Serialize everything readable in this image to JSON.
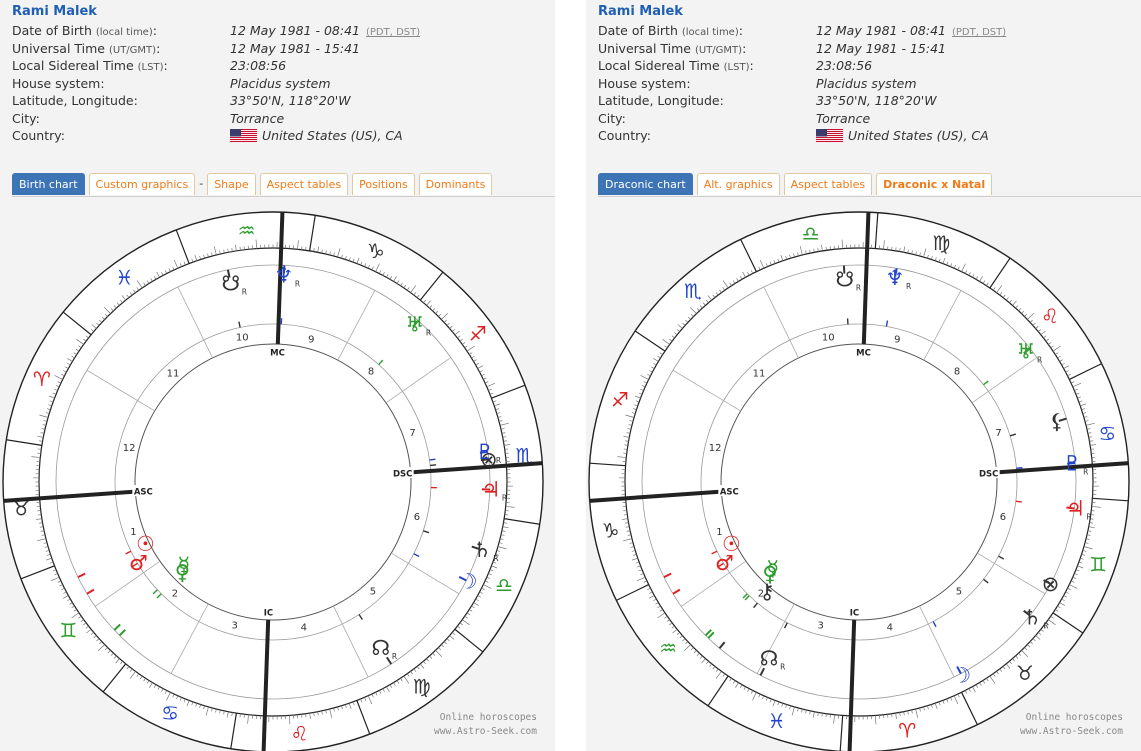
{
  "left": {
    "name": "Rami Malek",
    "fields": [
      {
        "label": "Date of Birth ",
        "small": "(local time)",
        "label_end": ":",
        "value": "12 May 1981 - 08:41",
        "note": "(PDT, DST)"
      },
      {
        "label": "Universal Time ",
        "small": "(UT/GMT)",
        "label_end": ":",
        "value": "12 May 1981 - 15:41"
      },
      {
        "label": "Local Sidereal Time ",
        "small": "(LST)",
        "label_end": ":",
        "value": "23:08:56"
      },
      {
        "label": "House system:",
        "small": "",
        "label_end": "",
        "value": "Placidus system"
      },
      {
        "label": "Latitude, Longitude:",
        "small": "",
        "label_end": "",
        "value": "33°50'N, 118°20'W"
      },
      {
        "label": "City:",
        "small": "",
        "label_end": "",
        "value": "Torrance"
      },
      {
        "label": "Country:",
        "small": "",
        "label_end": "",
        "value": "United States (US), CA"
      }
    ],
    "tabs": [
      "Birth chart",
      "Custom graphics",
      "-",
      "Shape",
      "Aspect tables",
      "Positions",
      "Dominants"
    ],
    "chart": {
      "signs": [
        "♈",
        "♉",
        "♊",
        "♋",
        "♌",
        "♍",
        "♎",
        "♏",
        "♐",
        "♑",
        "♒",
        "♓"
      ],
      "sign_colors": [
        "#e02020",
        "#333333",
        "#2c9d2c",
        "#2244cc",
        "#e02020",
        "#333333",
        "#2c9d2c",
        "#2244cc",
        "#e02020",
        "#333333",
        "#2c9d2c",
        "#2244cc"
      ],
      "house_numbers": [
        "1",
        "2",
        "3",
        "4",
        "5",
        "6",
        "7",
        "8",
        "9",
        "10",
        "11",
        "12"
      ],
      "angle_labels": {
        "asc": "ASC",
        "dsc": "DSC",
        "mc": "MC",
        "ic": "IC"
      },
      "planets": [
        {
          "glyph": "♂",
          "color": "#e02020"
        },
        {
          "glyph": "☉",
          "color": "#e02020"
        },
        {
          "glyph": "♀",
          "color": "#2c9d2c"
        },
        {
          "glyph": "☿",
          "color": "#2c9d2c"
        },
        {
          "glyph": "☊",
          "color": "#333333",
          "retro": "R"
        },
        {
          "glyph": "☽",
          "color": "#2244cc"
        },
        {
          "glyph": "♃",
          "color": "#e02020",
          "retro": "R"
        },
        {
          "glyph": "♄",
          "color": "#333333",
          "retro": "R"
        },
        {
          "glyph": "⊗",
          "color": "#333333"
        },
        {
          "glyph": "♇",
          "color": "#2244cc",
          "retro": "R"
        },
        {
          "glyph": "♅",
          "color": "#2c9d2c",
          "retro": "R"
        },
        {
          "glyph": "♆",
          "color": "#2244cc",
          "retro": "R"
        },
        {
          "glyph": "☋",
          "color": "#333333",
          "retro": "R"
        }
      ]
    },
    "watermark": [
      "Online horoscopes",
      "www.Astro-Seek.com"
    ]
  },
  "right": {
    "name": "Rami Malek",
    "fields": [
      {
        "label": "Date of Birth ",
        "small": "(local time)",
        "label_end": ":",
        "value": "12 May 1981 - 08:41",
        "note": "(PDT, DST)"
      },
      {
        "label": "Universal Time ",
        "small": "(UT/GMT)",
        "label_end": ":",
        "value": "12 May 1981 - 15:41"
      },
      {
        "label": "Local Sidereal Time ",
        "small": "(LST)",
        "label_end": ":",
        "value": "23:08:56"
      },
      {
        "label": "House system:",
        "small": "",
        "label_end": "",
        "value": "Placidus system"
      },
      {
        "label": "Latitude, Longitude:",
        "small": "",
        "label_end": "",
        "value": "33°50'N, 118°20'W"
      },
      {
        "label": "City:",
        "small": "",
        "label_end": "",
        "value": "Torrance"
      },
      {
        "label": "Country:",
        "small": "",
        "label_end": "",
        "value": "United States (US), CA"
      }
    ],
    "tabs": [
      "Draconic chart",
      "Alt. graphics",
      "Aspect tables",
      "Draconic x Natal"
    ],
    "chart": {
      "signs": [
        "♐",
        "♑",
        "♒",
        "♓",
        "♈",
        "♉",
        "♊",
        "♋",
        "♌",
        "♍",
        "♎",
        "♏"
      ],
      "sign_colors": [
        "#e02020",
        "#333333",
        "#2c9d2c",
        "#2244cc",
        "#e02020",
        "#333333",
        "#2c9d2c",
        "#2244cc",
        "#e02020",
        "#333333",
        "#2c9d2c",
        "#2244cc"
      ],
      "house_numbers": [
        "1",
        "2",
        "3",
        "4",
        "5",
        "6",
        "7",
        "8",
        "9",
        "10",
        "11",
        "12"
      ],
      "angle_labels": {
        "asc": "ASC",
        "dsc": "DSC",
        "mc": "MC",
        "ic": "IC"
      },
      "planets": [
        {
          "glyph": "♂",
          "color": "#e02020"
        },
        {
          "glyph": "☉",
          "color": "#e02020"
        },
        {
          "glyph": "⚷",
          "color": "#333333"
        },
        {
          "glyph": "♀",
          "color": "#2c9d2c"
        },
        {
          "glyph": "☿",
          "color": "#2c9d2c"
        },
        {
          "glyph": "☊",
          "color": "#333333",
          "retro": "R"
        },
        {
          "glyph": "☽",
          "color": "#2244cc"
        },
        {
          "glyph": "♃",
          "color": "#e02020",
          "retro": "R"
        },
        {
          "glyph": "♄",
          "color": "#333333",
          "retro": "R"
        },
        {
          "glyph": "⊗",
          "color": "#333333"
        },
        {
          "glyph": "♇",
          "color": "#2244cc",
          "retro": "R"
        },
        {
          "glyph": "⚸",
          "color": "#333333"
        },
        {
          "glyph": "♅",
          "color": "#2c9d2c",
          "retro": "R"
        },
        {
          "glyph": "♆",
          "color": "#2244cc",
          "retro": "R"
        },
        {
          "glyph": "☋",
          "color": "#333333",
          "retro": "R"
        }
      ]
    },
    "watermark": [
      "Online horoscopes",
      "www.Astro-Seek.com"
    ]
  },
  "colors": {
    "accent": "#3d74b5",
    "tab_text": "#f07a18",
    "name": "#1f5fb3"
  }
}
